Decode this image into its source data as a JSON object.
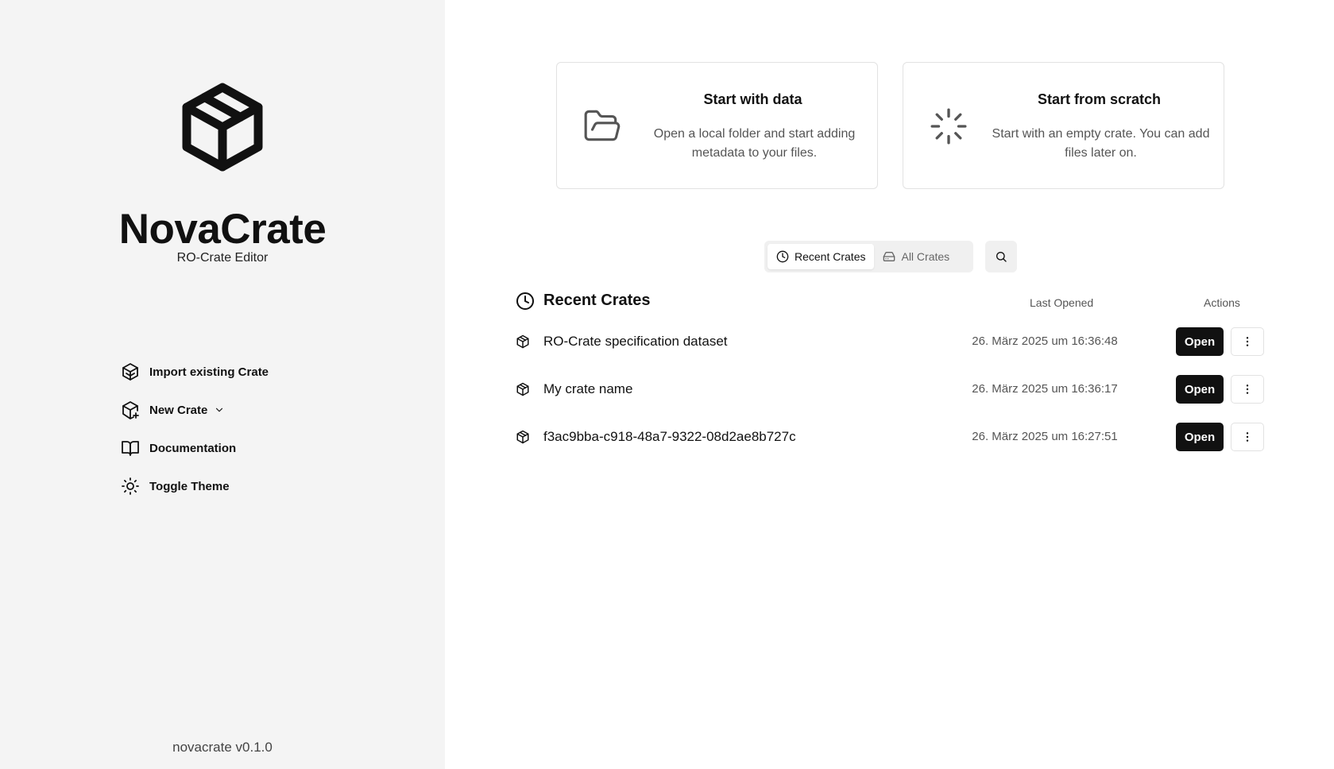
{
  "sidebar": {
    "app_title": "NovaCrate",
    "app_subtitle": "RO-Crate Editor",
    "logo_icon": "package-icon",
    "nav": [
      {
        "label": "Import existing Crate",
        "icon": "package-import-icon"
      },
      {
        "label": "New Crate",
        "icon": "package-plus-icon"
      },
      {
        "label": "Documentation",
        "icon": "book-open-icon"
      },
      {
        "label": "Toggle Theme",
        "icon": "sun-icon"
      }
    ],
    "version": "novacrate v0.1.0"
  },
  "cards": [
    {
      "title": "Start with data",
      "description": "Open a local folder and start adding metadata to your files.",
      "icon": "folder-open-icon"
    },
    {
      "title": "Start from scratch",
      "description": "Start with an empty crate. You can add files later on.",
      "icon": "loader-icon"
    }
  ],
  "tabs": [
    {
      "label": "Recent Crates",
      "icon": "clock-icon",
      "active": true
    },
    {
      "label": "All Crates",
      "icon": "hard-drive-icon",
      "active": false
    }
  ],
  "list": {
    "title": "Recent Crates",
    "col_last_opened": "Last Opened",
    "col_actions": "Actions",
    "open_label": "Open",
    "rows": [
      {
        "name": "RO-Crate specification dataset",
        "last_opened": "26. März 2025 um 16:36:48"
      },
      {
        "name": "My crate name",
        "last_opened": "26. März 2025 um 16:36:17"
      },
      {
        "name": "f3ac9bba-c918-48a7-9322-08d2ae8b727c",
        "last_opened": "26. März 2025 um 16:27:51"
      }
    ]
  },
  "colors": {
    "sidebar_bg": "#f4f4f4",
    "primary_button": "#111111",
    "muted_text": "#555555"
  }
}
